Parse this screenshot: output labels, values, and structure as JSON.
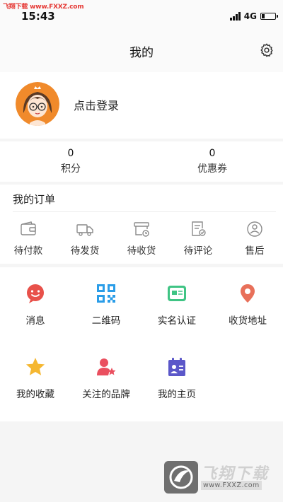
{
  "watermark_top": "飞翔下载 www.FXXZ.com",
  "status": {
    "time": "15:43",
    "network": "4G"
  },
  "nav": {
    "title": "我的"
  },
  "profile": {
    "login_label": "点击登录"
  },
  "stats": [
    {
      "value": "0",
      "label": "积分"
    },
    {
      "value": "0",
      "label": "优惠券"
    }
  ],
  "orders": {
    "title": "我的订单",
    "items": [
      {
        "label": "待付款",
        "icon": "wallet-icon"
      },
      {
        "label": "待发货",
        "icon": "truck-icon"
      },
      {
        "label": "待收货",
        "icon": "package-clock-icon"
      },
      {
        "label": "待评论",
        "icon": "review-icon"
      },
      {
        "label": "售后",
        "icon": "after-sales-icon"
      }
    ]
  },
  "services": [
    {
      "label": "消息",
      "icon": "message-icon",
      "color": "#e8514a"
    },
    {
      "label": "二维码",
      "icon": "qr-code-icon",
      "color": "#2a9de8"
    },
    {
      "label": "实名认证",
      "icon": "id-card-icon",
      "color": "#3fc484"
    },
    {
      "label": "收货地址",
      "icon": "location-pin-icon",
      "color": "#e8705a"
    },
    {
      "label": "我的收藏",
      "icon": "star-icon",
      "color": "#f5b731"
    },
    {
      "label": "关注的品牌",
      "icon": "user-star-icon",
      "color": "#ea4f5f"
    },
    {
      "label": "我的主页",
      "icon": "homepage-icon",
      "color": "#5b57c9"
    }
  ],
  "watermark_bottom": {
    "brand": "飞翔下载",
    "url": "www.FXXZ.com"
  }
}
